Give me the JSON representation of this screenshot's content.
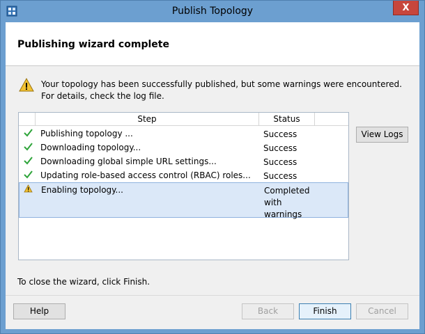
{
  "window": {
    "title": "Publish Topology",
    "close_label": "X"
  },
  "header": {
    "title": "Publishing wizard complete"
  },
  "message": {
    "text": "Your topology has been successfully published, but some warnings were encountered. For details, check the log file."
  },
  "table": {
    "columns": [
      "",
      "Step",
      "Status"
    ],
    "rows": [
      {
        "icon": "success-check-icon",
        "step": "Publishing topology ...",
        "status": "Success"
      },
      {
        "icon": "success-check-icon",
        "step": "Downloading topology...",
        "status": "Success"
      },
      {
        "icon": "success-check-icon",
        "step": "Downloading global simple URL settings...",
        "status": "Success"
      },
      {
        "icon": "success-check-icon",
        "step": "Updating role-based access control (RBAC) roles...",
        "status": "Success"
      },
      {
        "icon": "warning-icon",
        "step": "Enabling topology...",
        "status": "Completed\nwith\nwarnings"
      }
    ]
  },
  "buttons": {
    "view_logs": "View Logs",
    "help": "Help",
    "back": "Back",
    "finish": "Finish",
    "cancel": "Cancel"
  },
  "footer": {
    "instruction": "To close the wizard, click Finish."
  },
  "colors": {
    "title_bar": "#6c9fd0",
    "close_button": "#c7463c",
    "success_green": "#2ea43a",
    "warning_yellow": "#f2c232",
    "selection": "#dbe8f8"
  }
}
